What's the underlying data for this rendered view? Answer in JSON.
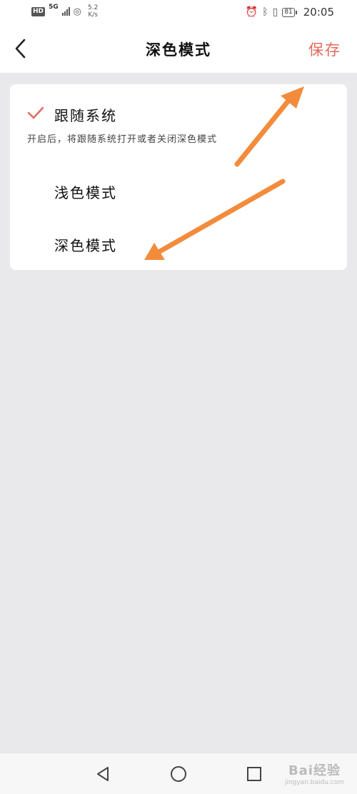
{
  "status_bar": {
    "network_badge": "HD",
    "signal_type": "5G",
    "speed_value": "5.2",
    "speed_unit": "K/s",
    "battery": "81",
    "time": "20:05"
  },
  "header": {
    "title": "深色模式",
    "save_label": "保存"
  },
  "options": [
    {
      "label": "跟随系统",
      "checked": true
    },
    {
      "label": "浅色模式",
      "checked": false
    },
    {
      "label": "深色模式",
      "checked": false
    }
  ],
  "follow_system_description": "开启后，将跟随系统打开或者关闭深色模式",
  "watermark": {
    "main": "Bai经验",
    "sub": "jingyan.baidu.com"
  },
  "colors": {
    "accent": "#e06a5a",
    "annotation_arrow": "#f28c3c",
    "background": "#e9e9ec"
  },
  "icons": {
    "back": "chevron-left-icon",
    "check": "checkmark-icon",
    "nav_back": "triangle-back-icon",
    "nav_home": "circle-home-icon",
    "nav_recent": "square-recent-icon"
  }
}
